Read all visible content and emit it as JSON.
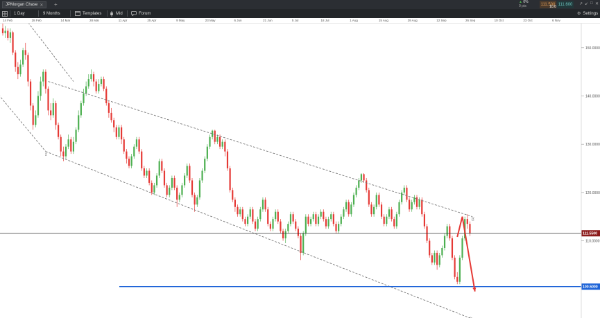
{
  "topbar": {
    "instrument_tab": "JPMorgan Chase",
    "tab_close": "✕",
    "add_tab": "+",
    "change_arrow": "▲",
    "change_value": "0%",
    "change_points": "0 pts",
    "sell_price": "111.500",
    "buy_price": "111.600",
    "spread": "10.0",
    "window_controls": [
      "↗",
      "↙",
      "□",
      "✕"
    ]
  },
  "toolbar": {
    "interval": "1 Day",
    "range": "9 Months",
    "templates": "Templates",
    "price_type": "Mid",
    "forum": "Forum",
    "settings": "Settings"
  },
  "date_axis": [
    "14 Feb",
    "28 Feb",
    "14 Mar",
    "28 Mar",
    "11 Apr",
    "25 Apr",
    "9 May",
    "23 May",
    "6 Jun",
    "21 Jun",
    "5 Jul",
    "18 Jul",
    "1 Aug",
    "15 Aug",
    "29 Aug",
    "12 Sep",
    "26 Sep",
    "10 Oct",
    "23 Oct",
    "6 Nov"
  ],
  "price_axis": [
    "150.0000",
    "140.0000",
    "130.0000",
    "120.0000",
    "110.0000"
  ],
  "current_price_label": "111.5500",
  "target_price_label": "100.5000",
  "colors": {
    "bull": "#4caf50",
    "bear": "#e53935",
    "arrow": "#e53935",
    "support_line": "#1e64d8",
    "current_line": "#333333",
    "channel": "#777777",
    "price_badge": "#8b1a1a"
  },
  "chart_data": {
    "type": "candlestick",
    "ylim": [
      94,
      155
    ],
    "bar_count": 190,
    "channel_labels": {
      "upper": "(1)",
      "lower": "(2)",
      "wave": "2"
    },
    "candles": [
      [
        154.0,
        153.0,
        155.0,
        152.5
      ],
      [
        153.0,
        153.5,
        154.5,
        152.0
      ],
      [
        153.5,
        152.0,
        154.0,
        151.5
      ],
      [
        152.0,
        153.2,
        154.0,
        151.0
      ],
      [
        153.2,
        149.0,
        153.5,
        148.5
      ],
      [
        149.0,
        146.0,
        149.5,
        145.0
      ],
      [
        146.0,
        144.5,
        147.0,
        143.5
      ],
      [
        144.5,
        146.5,
        147.5,
        144.0
      ],
      [
        146.5,
        149.5,
        150.0,
        146.0
      ],
      [
        149.5,
        148.5,
        151.0,
        147.5
      ],
      [
        148.5,
        143.0,
        149.0,
        142.0
      ],
      [
        143.0,
        138.0,
        143.5,
        137.0
      ],
      [
        138.0,
        134.0,
        138.5,
        133.0
      ],
      [
        134.0,
        136.0,
        137.0,
        133.5
      ],
      [
        136.0,
        140.0,
        141.0,
        135.5
      ],
      [
        140.0,
        143.0,
        144.0,
        139.0
      ],
      [
        143.0,
        145.0,
        145.5,
        142.0
      ],
      [
        145.0,
        141.5,
        145.5,
        140.5
      ],
      [
        141.5,
        137.0,
        142.0,
        136.0
      ],
      [
        137.0,
        136.0,
        138.5,
        135.0
      ],
      [
        136.0,
        138.5,
        139.5,
        135.5
      ],
      [
        138.5,
        134.0,
        139.0,
        133.0
      ],
      [
        134.0,
        131.5,
        134.5,
        131.0
      ],
      [
        131.5,
        128.5,
        132.0,
        127.5
      ],
      [
        128.5,
        127.5,
        129.5,
        126.5
      ],
      [
        127.5,
        129.5,
        130.0,
        127.0
      ],
      [
        129.5,
        131.0,
        132.0,
        129.0
      ],
      [
        131.0,
        128.5,
        131.5,
        128.0
      ],
      [
        128.5,
        130.5,
        131.5,
        128.0
      ],
      [
        130.5,
        133.0,
        133.5,
        130.0
      ],
      [
        133.0,
        136.0,
        137.0,
        132.5
      ],
      [
        136.0,
        138.5,
        139.0,
        135.5
      ],
      [
        138.5,
        140.5,
        141.5,
        138.0
      ],
      [
        140.5,
        142.0,
        143.0,
        140.0
      ],
      [
        142.0,
        143.5,
        144.5,
        141.5
      ],
      [
        143.5,
        144.5,
        145.5,
        143.0
      ],
      [
        144.5,
        143.0,
        145.0,
        142.0
      ],
      [
        143.0,
        141.0,
        143.5,
        140.5
      ],
      [
        141.0,
        142.5,
        143.5,
        140.5
      ],
      [
        142.5,
        143.5,
        144.0,
        142.0
      ],
      [
        143.5,
        141.5,
        144.0,
        141.0
      ],
      [
        141.5,
        138.5,
        142.0,
        138.0
      ],
      [
        138.5,
        136.5,
        139.0,
        135.5
      ],
      [
        136.5,
        135.0,
        137.5,
        134.5
      ],
      [
        135.0,
        133.5,
        135.5,
        132.5
      ],
      [
        133.5,
        131.5,
        134.0,
        131.0
      ],
      [
        131.5,
        133.5,
        134.0,
        131.0
      ],
      [
        133.5,
        131.0,
        134.0,
        130.0
      ],
      [
        131.0,
        128.5,
        131.5,
        128.0
      ],
      [
        128.5,
        127.0,
        129.0,
        126.0
      ],
      [
        127.0,
        125.5,
        127.5,
        125.0
      ],
      [
        125.5,
        127.5,
        128.0,
        125.0
      ],
      [
        127.5,
        129.5,
        130.0,
        127.0
      ],
      [
        129.5,
        131.0,
        131.5,
        129.0
      ],
      [
        131.0,
        128.5,
        131.5,
        128.0
      ],
      [
        128.5,
        125.0,
        129.0,
        124.5
      ],
      [
        125.0,
        123.5,
        125.5,
        123.0
      ],
      [
        123.5,
        124.5,
        125.0,
        123.0
      ],
      [
        124.5,
        122.0,
        125.0,
        121.5
      ],
      [
        122.0,
        120.0,
        122.5,
        119.5
      ],
      [
        120.0,
        121.5,
        122.0,
        119.5
      ],
      [
        121.5,
        123.5,
        124.0,
        121.0
      ],
      [
        123.5,
        126.5,
        127.0,
        123.0
      ],
      [
        126.5,
        124.5,
        127.0,
        124.0
      ],
      [
        124.5,
        121.5,
        125.0,
        121.0
      ],
      [
        121.5,
        119.5,
        122.0,
        119.0
      ],
      [
        119.5,
        121.0,
        121.5,
        119.0
      ],
      [
        121.0,
        123.0,
        123.5,
        120.5
      ],
      [
        123.0,
        121.0,
        123.5,
        120.5
      ],
      [
        121.0,
        118.5,
        121.5,
        117.0
      ],
      [
        118.5,
        119.5,
        120.0,
        118.0
      ],
      [
        119.5,
        121.5,
        122.0,
        119.0
      ],
      [
        121.5,
        123.5,
        124.0,
        121.0
      ],
      [
        123.5,
        125.5,
        126.0,
        123.0
      ],
      [
        125.5,
        122.5,
        126.0,
        122.0
      ],
      [
        122.5,
        119.5,
        123.0,
        119.0
      ],
      [
        119.5,
        117.5,
        120.0,
        116.0
      ],
      [
        117.5,
        119.0,
        119.5,
        117.0
      ],
      [
        119.0,
        122.5,
        123.0,
        118.5
      ],
      [
        122.5,
        124.5,
        125.0,
        122.0
      ],
      [
        124.5,
        127.0,
        127.5,
        124.0
      ],
      [
        127.0,
        129.5,
        130.0,
        126.5
      ],
      [
        129.5,
        131.5,
        132.0,
        129.0
      ],
      [
        131.5,
        132.8,
        133.0,
        131.0
      ],
      [
        132.8,
        130.5,
        133.0,
        130.0
      ],
      [
        130.5,
        131.5,
        132.0,
        130.0
      ],
      [
        131.5,
        129.5,
        132.0,
        129.0
      ],
      [
        129.5,
        130.5,
        131.0,
        129.0
      ],
      [
        130.5,
        128.5,
        131.0,
        127.5
      ],
      [
        128.5,
        125.0,
        129.0,
        124.5
      ],
      [
        125.0,
        120.5,
        125.5,
        120.0
      ],
      [
        120.5,
        118.5,
        121.0,
        118.0
      ],
      [
        118.5,
        117.0,
        119.0,
        116.0
      ],
      [
        117.0,
        115.5,
        117.5,
        115.0
      ],
      [
        115.5,
        116.5,
        117.0,
        115.0
      ],
      [
        116.5,
        114.5,
        117.0,
        114.0
      ],
      [
        114.5,
        113.5,
        115.0,
        113.0
      ],
      [
        113.5,
        115.0,
        115.5,
        113.0
      ],
      [
        115.0,
        116.5,
        117.0,
        114.5
      ],
      [
        116.5,
        114.0,
        117.0,
        113.5
      ],
      [
        114.0,
        112.5,
        114.5,
        112.0
      ],
      [
        112.5,
        114.5,
        115.0,
        112.0
      ],
      [
        114.5,
        116.5,
        117.0,
        114.0
      ],
      [
        116.5,
        118.5,
        119.0,
        116.0
      ],
      [
        118.5,
        116.5,
        119.0,
        116.0
      ],
      [
        116.5,
        113.5,
        117.0,
        113.0
      ],
      [
        113.5,
        112.5,
        114.0,
        112.0
      ],
      [
        112.5,
        114.5,
        115.0,
        112.0
      ],
      [
        114.5,
        116.0,
        116.5,
        114.0
      ],
      [
        116.0,
        114.0,
        116.5,
        113.5
      ],
      [
        114.0,
        112.0,
        114.5,
        111.5
      ],
      [
        112.0,
        110.5,
        112.5,
        110.0
      ],
      [
        110.5,
        112.0,
        112.5,
        109.5
      ],
      [
        112.0,
        113.5,
        114.0,
        111.5
      ],
      [
        113.5,
        115.5,
        116.0,
        113.0
      ],
      [
        115.5,
        114.0,
        116.0,
        113.5
      ],
      [
        114.0,
        112.5,
        114.5,
        112.0
      ],
      [
        112.5,
        111.0,
        113.0,
        110.5
      ],
      [
        111.0,
        107.5,
        111.5,
        106.0
      ],
      [
        107.5,
        111.5,
        112.0,
        107.0
      ],
      [
        111.5,
        115.0,
        115.5,
        111.0
      ],
      [
        115.0,
        113.5,
        115.5,
        113.0
      ],
      [
        113.5,
        114.5,
        115.0,
        113.0
      ],
      [
        114.5,
        115.5,
        116.0,
        114.0
      ],
      [
        115.5,
        113.5,
        116.0,
        113.0
      ],
      [
        113.5,
        115.0,
        115.5,
        113.0
      ],
      [
        115.0,
        116.0,
        116.5,
        114.5
      ],
      [
        116.0,
        114.5,
        116.5,
        114.0
      ],
      [
        114.5,
        113.0,
        115.0,
        112.5
      ],
      [
        113.0,
        114.5,
        115.0,
        112.5
      ],
      [
        114.5,
        115.5,
        116.0,
        114.0
      ],
      [
        115.5,
        113.5,
        116.0,
        113.0
      ],
      [
        113.5,
        112.0,
        114.0,
        111.5
      ],
      [
        112.0,
        113.5,
        114.0,
        111.5
      ],
      [
        113.5,
        115.0,
        115.5,
        113.0
      ],
      [
        115.0,
        116.5,
        117.0,
        114.5
      ],
      [
        116.5,
        118.0,
        118.5,
        116.0
      ],
      [
        118.0,
        115.5,
        118.5,
        115.0
      ],
      [
        115.5,
        117.5,
        118.0,
        115.0
      ],
      [
        117.5,
        119.5,
        120.0,
        117.0
      ],
      [
        119.5,
        121.0,
        121.5,
        119.0
      ],
      [
        121.0,
        122.5,
        123.0,
        120.5
      ],
      [
        122.5,
        123.8,
        124.0,
        122.0
      ],
      [
        123.8,
        122.5,
        124.0,
        122.0
      ],
      [
        122.5,
        120.5,
        123.0,
        120.0
      ],
      [
        120.5,
        117.5,
        121.0,
        117.0
      ],
      [
        117.5,
        115.5,
        118.0,
        115.0
      ],
      [
        115.5,
        117.0,
        117.5,
        115.0
      ],
      [
        117.0,
        119.5,
        120.0,
        116.5
      ],
      [
        119.5,
        117.5,
        120.0,
        117.0
      ],
      [
        117.5,
        115.0,
        118.0,
        114.5
      ],
      [
        115.0,
        113.5,
        115.5,
        113.0
      ],
      [
        113.5,
        115.0,
        115.5,
        113.0
      ],
      [
        115.0,
        116.5,
        117.0,
        114.5
      ],
      [
        116.5,
        114.5,
        117.0,
        114.0
      ],
      [
        114.5,
        113.0,
        115.0,
        112.5
      ],
      [
        113.0,
        115.5,
        116.0,
        112.5
      ],
      [
        115.5,
        118.0,
        118.5,
        115.0
      ],
      [
        118.0,
        120.0,
        120.5,
        117.5
      ],
      [
        120.0,
        121.0,
        121.5,
        119.5
      ],
      [
        121.0,
        118.5,
        121.5,
        118.0
      ],
      [
        118.5,
        116.5,
        119.0,
        116.0
      ],
      [
        116.5,
        118.0,
        118.5,
        116.0
      ],
      [
        118.0,
        119.0,
        119.5,
        117.5
      ],
      [
        119.0,
        117.0,
        119.5,
        116.5
      ],
      [
        117.0,
        118.5,
        119.0,
        116.5
      ],
      [
        118.5,
        115.5,
        119.0,
        115.0
      ],
      [
        115.5,
        113.0,
        116.0,
        112.5
      ],
      [
        113.0,
        110.0,
        113.5,
        109.5
      ],
      [
        110.0,
        107.0,
        110.5,
        106.5
      ],
      [
        107.0,
        105.5,
        107.5,
        105.0
      ],
      [
        105.5,
        107.5,
        108.0,
        105.0
      ],
      [
        107.5,
        105.0,
        108.0,
        104.0
      ],
      [
        105.0,
        107.0,
        107.5,
        104.5
      ],
      [
        107.0,
        108.5,
        109.0,
        106.5
      ],
      [
        108.5,
        111.0,
        111.5,
        108.0
      ],
      [
        111.0,
        113.0,
        113.5,
        110.5
      ],
      [
        113.0,
        110.5,
        113.5,
        110.0
      ],
      [
        110.5,
        106.5,
        111.0,
        106.0
      ],
      [
        106.5,
        102.5,
        107.0,
        102.0
      ],
      [
        102.5,
        101.5,
        103.5,
        101.0
      ],
      [
        101.5,
        106.5,
        107.0,
        101.0
      ],
      [
        106.5,
        110.5,
        111.0,
        106.0
      ],
      [
        110.5,
        114.5,
        115.0,
        110.0
      ],
      [
        114.5,
        113.5,
        115.5,
        112.5
      ],
      [
        113.5,
        111.5,
        114.0,
        111.0
      ]
    ],
    "upper_channel": [
      [
        18,
        143.0
      ],
      [
        186,
        115.0
      ]
    ],
    "upper_channel_left": [
      [
        0,
        162.0
      ],
      [
        28,
        143.0
      ]
    ],
    "lower_channel": [
      [
        17,
        128.5
      ],
      [
        185,
        94.0
      ]
    ],
    "lower_channel_left": [
      [
        -6,
        143.0
      ],
      [
        17,
        128.5
      ]
    ],
    "current_price": 111.55,
    "target_price": 100.5,
    "arrow_path": [
      [
        180,
        110.8
      ],
      [
        182,
        115.0
      ],
      [
        187,
        99.5
      ]
    ]
  }
}
